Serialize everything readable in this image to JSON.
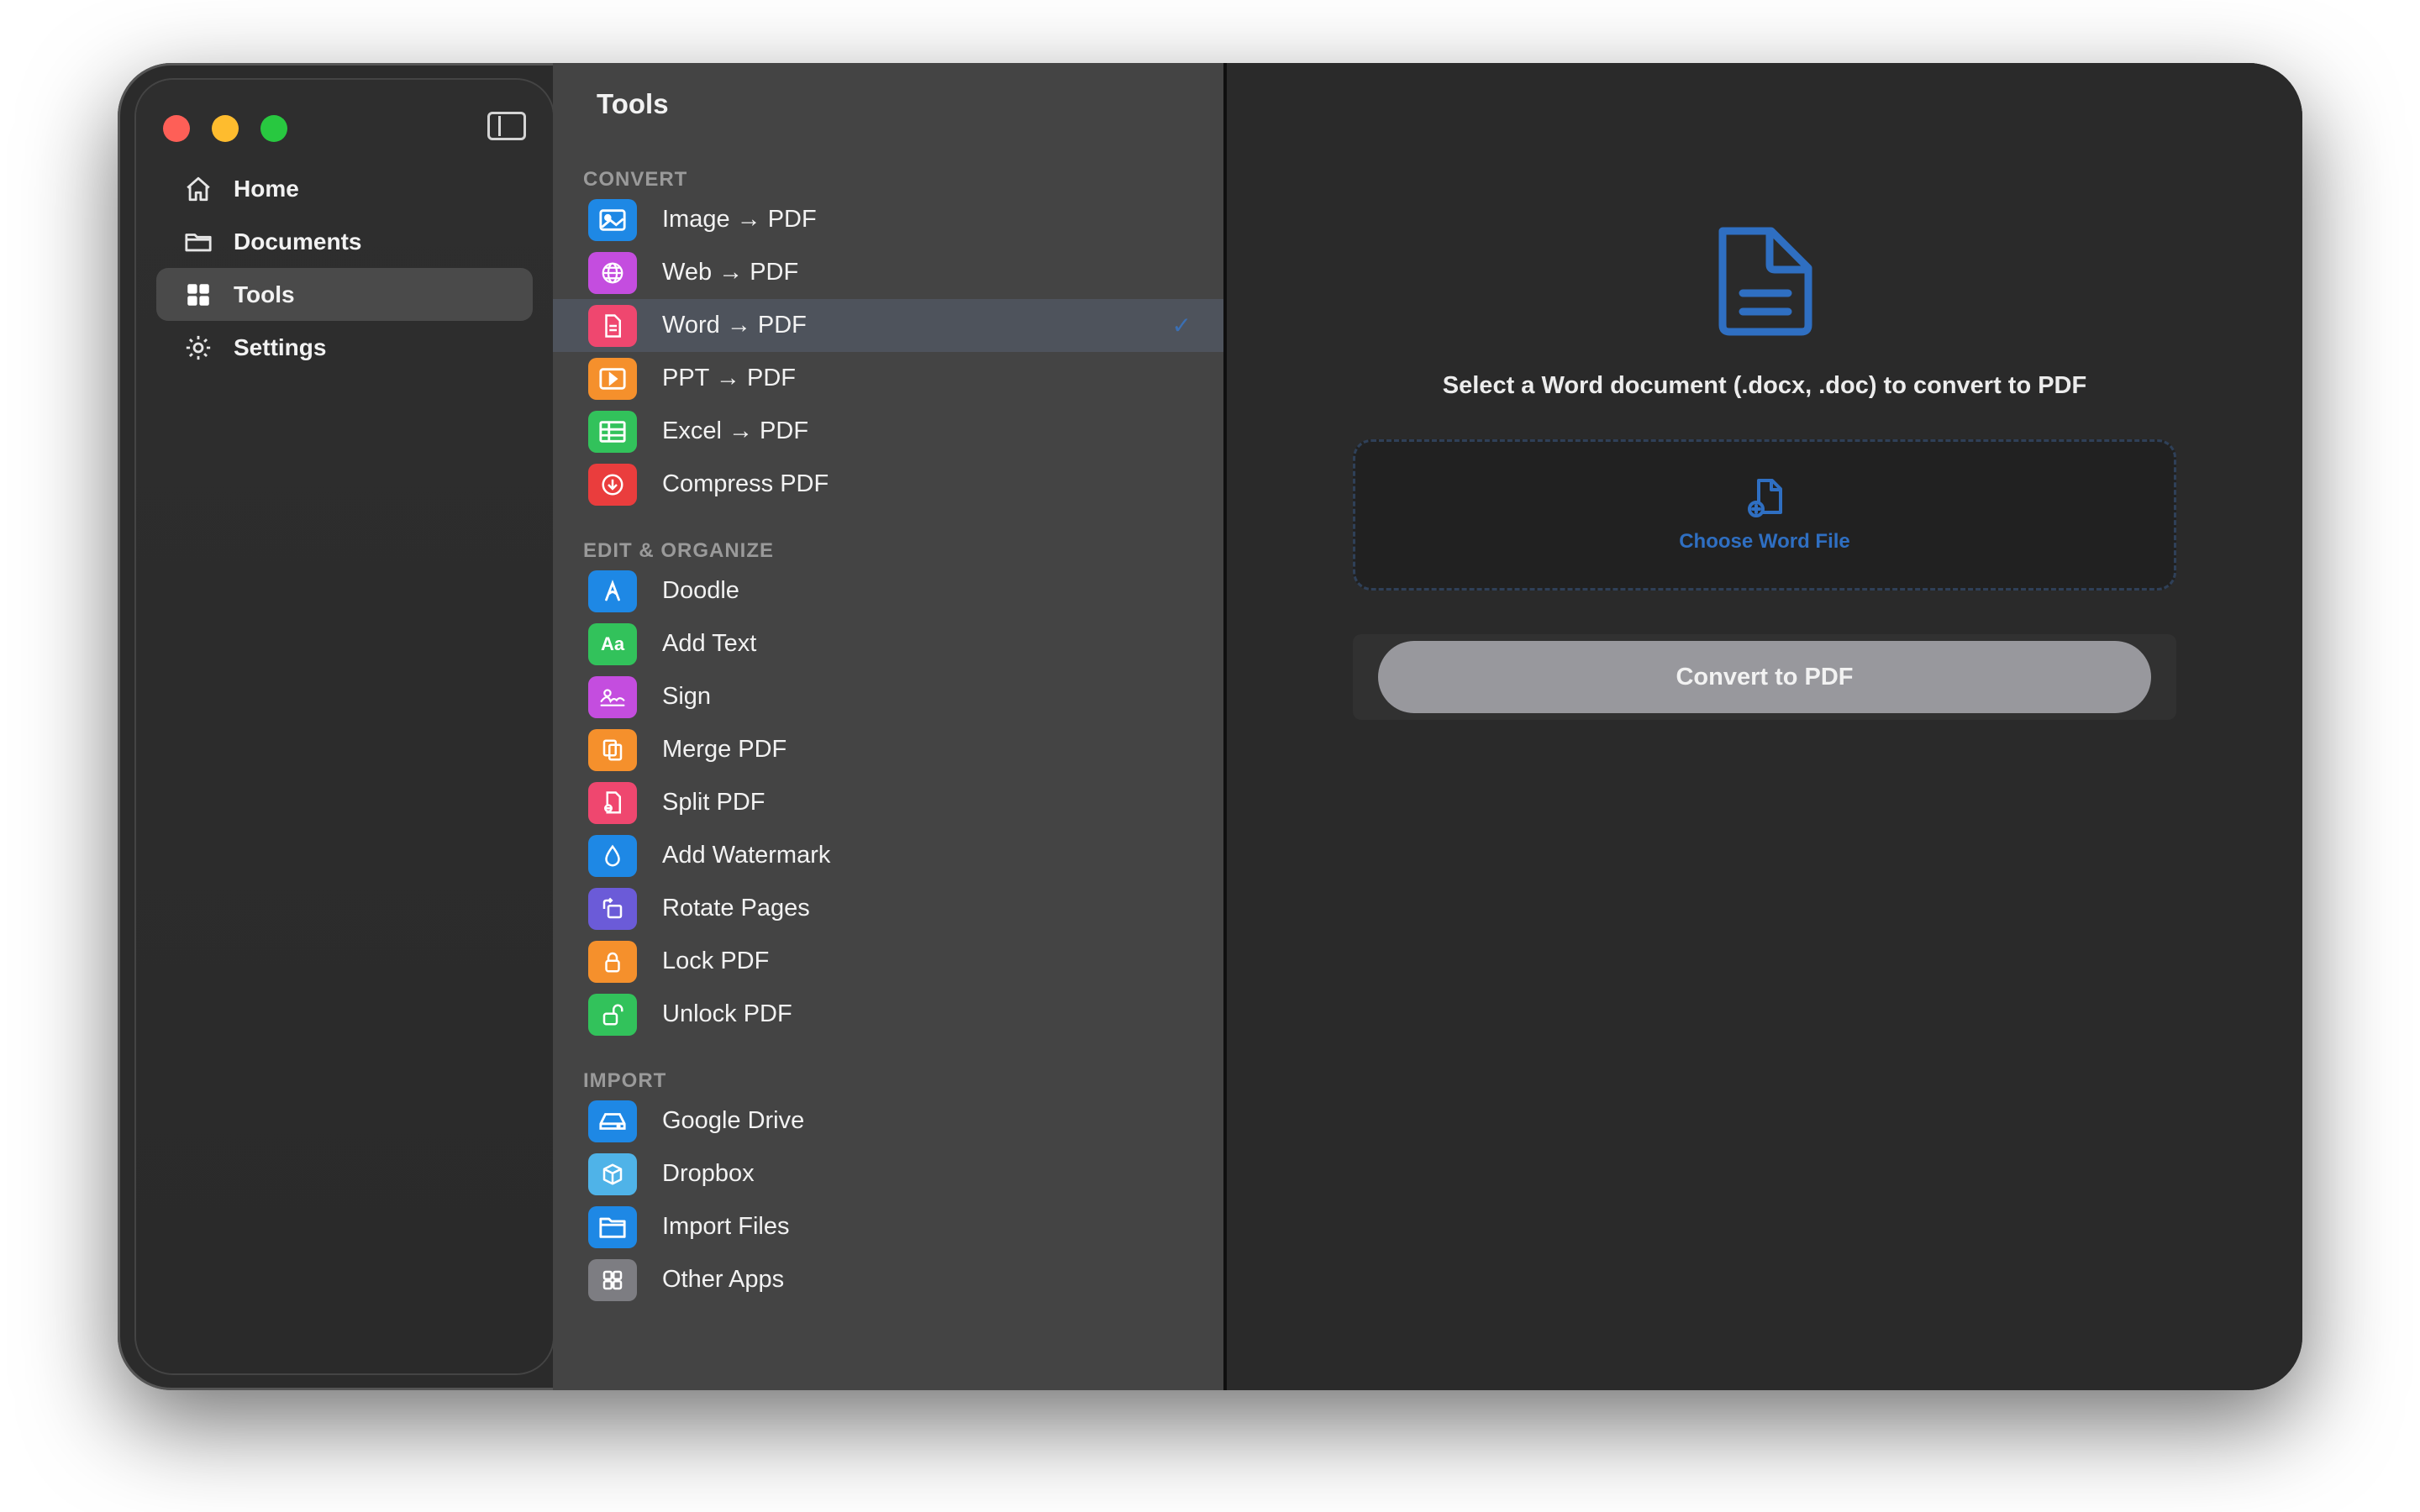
{
  "window": {
    "title": "Tools"
  },
  "sidebar": {
    "items": [
      {
        "label": "Home",
        "icon": "house-icon"
      },
      {
        "label": "Documents",
        "icon": "folder-icon"
      },
      {
        "label": "Tools",
        "icon": "grid-icon",
        "active": true
      },
      {
        "label": "Settings",
        "icon": "gear-icon"
      }
    ]
  },
  "tools": {
    "title": "Tools",
    "sections": [
      {
        "label": "CONVERT",
        "items": [
          {
            "label": "Image → PDF",
            "icon": "image-icon",
            "color": "#1e88e5"
          },
          {
            "label": "Web → PDF",
            "icon": "globe-icon",
            "color": "#c44ddf"
          },
          {
            "label": "Word → PDF",
            "icon": "word-doc-icon",
            "color": "#ef476f",
            "selected": true
          },
          {
            "label": "PPT → PDF",
            "icon": "presentation-icon",
            "color": "#f5902c"
          },
          {
            "label": "Excel → PDF",
            "icon": "table-icon",
            "color": "#32c25b"
          },
          {
            "label": "Compress PDF",
            "icon": "compress-icon",
            "color": "#ea3d3d"
          }
        ]
      },
      {
        "label": "EDIT & ORGANIZE",
        "items": [
          {
            "label": "Doodle",
            "icon": "pen-nib-icon",
            "color": "#1e88e5"
          },
          {
            "label": "Add Text",
            "icon": "text-aa-icon",
            "color": "#32c25b"
          },
          {
            "label": "Sign",
            "icon": "signature-icon",
            "color": "#c44ddf"
          },
          {
            "label": "Merge PDF",
            "icon": "merge-icon",
            "color": "#f5902c"
          },
          {
            "label": "Split PDF",
            "icon": "split-icon",
            "color": "#ef476f"
          },
          {
            "label": "Add Watermark",
            "icon": "drop-icon",
            "color": "#1e88e5"
          },
          {
            "label": "Rotate Pages",
            "icon": "rotate-icon",
            "color": "#6b5bd8"
          },
          {
            "label": "Lock PDF",
            "icon": "lock-icon",
            "color": "#f5902c"
          },
          {
            "label": "Unlock PDF",
            "icon": "unlock-icon",
            "color": "#32c25b"
          }
        ]
      },
      {
        "label": "IMPORT",
        "items": [
          {
            "label": "Google Drive",
            "icon": "drive-icon",
            "color": "#1e88e5"
          },
          {
            "label": "Dropbox",
            "icon": "box-icon",
            "color": "#4fb3e8"
          },
          {
            "label": "Import Files",
            "icon": "folder-icon",
            "color": "#1e88e5"
          },
          {
            "label": "Other Apps",
            "icon": "apps-grid-icon",
            "color": "#7d7d82"
          }
        ]
      }
    ]
  },
  "main": {
    "prompt": "Select a Word document (.docx, .doc) to convert to PDF",
    "dropzone_label": "Choose Word File",
    "convert_label": "Convert to PDF",
    "accent": "#2f6fc2"
  }
}
